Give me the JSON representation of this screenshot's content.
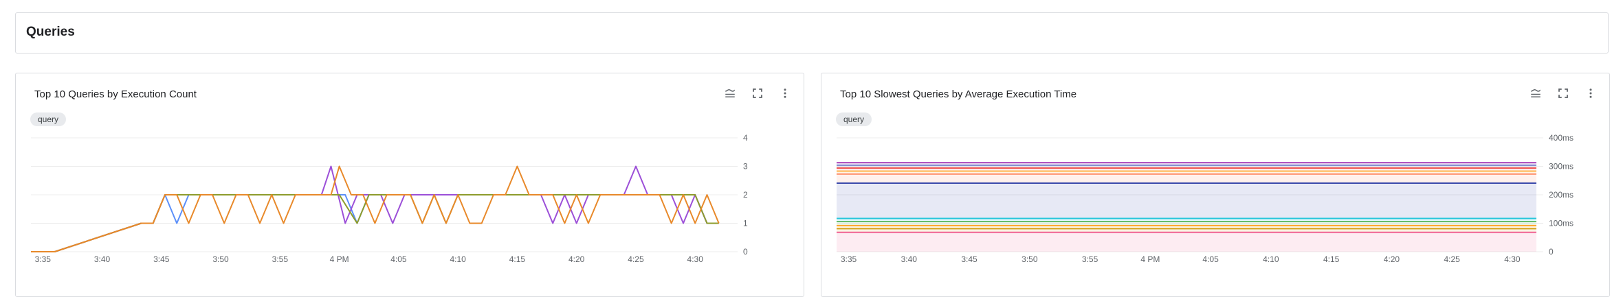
{
  "section": {
    "title": "Queries"
  },
  "panels": [
    {
      "title": "Top 10 Queries by Execution Count",
      "chip": "query",
      "icons": [
        "legend-icon",
        "fullscreen-icon",
        "more-vert-icon"
      ]
    },
    {
      "title": "Top 10 Slowest Queries by Average Execution Time",
      "chip": "query",
      "icons": [
        "legend-icon",
        "fullscreen-icon",
        "more-vert-icon"
      ]
    }
  ],
  "chart_data": [
    {
      "type": "line",
      "title": "Top 10 Queries by Execution Count",
      "x_tick_labels": [
        "3:35",
        "3:40",
        "3:45",
        "3:50",
        "3:55",
        "4 PM",
        "4:05",
        "4:10",
        "4:15",
        "4:20",
        "4:25",
        "4:30"
      ],
      "x_ticks_minutes": [
        0,
        5,
        10,
        15,
        20,
        25,
        30,
        35,
        40,
        45,
        50,
        55
      ],
      "y_tick_labels": [
        "0",
        "1",
        "2",
        "3",
        "4"
      ],
      "ylim": [
        0,
        4
      ],
      "xlim_minutes": [
        -1,
        58
      ],
      "grid": true,
      "series": [
        {
          "color": "#5b8ff9",
          "points": [
            [
              -1,
              0
            ],
            [
              1,
              0
            ],
            [
              8.3,
              1
            ],
            [
              9.3,
              1
            ],
            [
              10.3,
              2
            ],
            [
              11.3,
              1
            ],
            [
              12.3,
              2
            ],
            [
              25.5,
              2
            ],
            [
              26.5,
              1
            ],
            [
              27.5,
              2
            ],
            [
              30,
              2
            ],
            [
              55,
              2
            ],
            [
              56,
              1
            ],
            [
              57,
              1
            ]
          ]
        },
        {
          "color": "#9c4fd8",
          "points": [
            [
              -1,
              0
            ],
            [
              1,
              0
            ],
            [
              8.3,
              1
            ],
            [
              9.3,
              1
            ],
            [
              10.3,
              2
            ],
            [
              23.5,
              2
            ],
            [
              24.3,
              3
            ],
            [
              25.5,
              1
            ],
            [
              26.5,
              2
            ],
            [
              28.5,
              2
            ],
            [
              29.5,
              1
            ],
            [
              30.5,
              2
            ],
            [
              42,
              2
            ],
            [
              43,
              1
            ],
            [
              44,
              2
            ],
            [
              45,
              1
            ],
            [
              46,
              2
            ],
            [
              49,
              2
            ],
            [
              50,
              3
            ],
            [
              51,
              2
            ],
            [
              53,
              2
            ],
            [
              54,
              1
            ],
            [
              55,
              2
            ],
            [
              56,
              1
            ],
            [
              57,
              1
            ]
          ]
        },
        {
          "color": "#8d9c2c",
          "points": [
            [
              -1,
              0
            ],
            [
              1,
              0
            ],
            [
              8.3,
              1
            ],
            [
              9.3,
              1
            ],
            [
              10.3,
              2
            ],
            [
              25,
              2
            ],
            [
              26.5,
              1
            ],
            [
              27.5,
              2
            ],
            [
              31,
              2
            ],
            [
              32,
              1
            ],
            [
              33,
              2
            ],
            [
              34,
              1
            ],
            [
              35,
              2
            ],
            [
              55,
              2
            ],
            [
              56,
              1
            ],
            [
              57,
              1
            ]
          ]
        },
        {
          "color": "#e8892a",
          "points": [
            [
              -1,
              0
            ],
            [
              1,
              0
            ],
            [
              8.3,
              1
            ],
            [
              9.3,
              1
            ],
            [
              10.3,
              2
            ],
            [
              11.3,
              2
            ],
            [
              12.3,
              1
            ],
            [
              13.3,
              2
            ],
            [
              14.3,
              2
            ],
            [
              15.3,
              1
            ],
            [
              16.3,
              2
            ],
            [
              17.3,
              2
            ],
            [
              18.3,
              1
            ],
            [
              19.3,
              2
            ],
            [
              20.3,
              1
            ],
            [
              21.3,
              2
            ],
            [
              24.3,
              2
            ],
            [
              25,
              3
            ],
            [
              26,
              2
            ],
            [
              27,
              2
            ],
            [
              28,
              1
            ],
            [
              29,
              2
            ],
            [
              31,
              2
            ],
            [
              32,
              1
            ],
            [
              33,
              2
            ],
            [
              34,
              1
            ],
            [
              35,
              2
            ],
            [
              36,
              1
            ],
            [
              37,
              1
            ],
            [
              38,
              2
            ],
            [
              39,
              2
            ],
            [
              40,
              3
            ],
            [
              41,
              2
            ],
            [
              43,
              2
            ],
            [
              44,
              1
            ],
            [
              45,
              2
            ],
            [
              46,
              1
            ],
            [
              47,
              2
            ],
            [
              52,
              2
            ],
            [
              53,
              1
            ],
            [
              54,
              2
            ],
            [
              55,
              1
            ],
            [
              56,
              2
            ],
            [
              57,
              1
            ]
          ]
        }
      ]
    },
    {
      "type": "area",
      "title": "Top 10 Slowest Queries by Average Execution Time",
      "x_tick_labels": [
        "3:35",
        "3:40",
        "3:45",
        "3:50",
        "3:55",
        "4 PM",
        "4:05",
        "4:10",
        "4:15",
        "4:20",
        "4:25",
        "4:30"
      ],
      "x_ticks_minutes": [
        0,
        5,
        10,
        15,
        20,
        25,
        30,
        35,
        40,
        45,
        50,
        55
      ],
      "y_tick_labels": [
        "0",
        "100ms",
        "200ms",
        "300ms",
        "400ms"
      ],
      "ylim": [
        0,
        400
      ],
      "xlim_minutes": [
        -1,
        57
      ],
      "grid": true,
      "series": [
        {
          "color": "#ab47bc",
          "value": 313
        },
        {
          "color": "#7986cb",
          "value": 304
        },
        {
          "color": "#ef5350",
          "value": 294
        },
        {
          "color": "#ffb74d",
          "value": 283
        },
        {
          "color": "#ff8a65",
          "value": 273
        },
        {
          "color": "#3949ab",
          "value": 241
        },
        {
          "color": "#26c6da",
          "value": 117
        },
        {
          "color": "#66bb6a",
          "value": 106
        },
        {
          "color": "#ffa726",
          "value": 92
        },
        {
          "color": "#d4a017",
          "value": 81
        },
        {
          "color": "#f06292",
          "value": 68
        }
      ]
    }
  ]
}
